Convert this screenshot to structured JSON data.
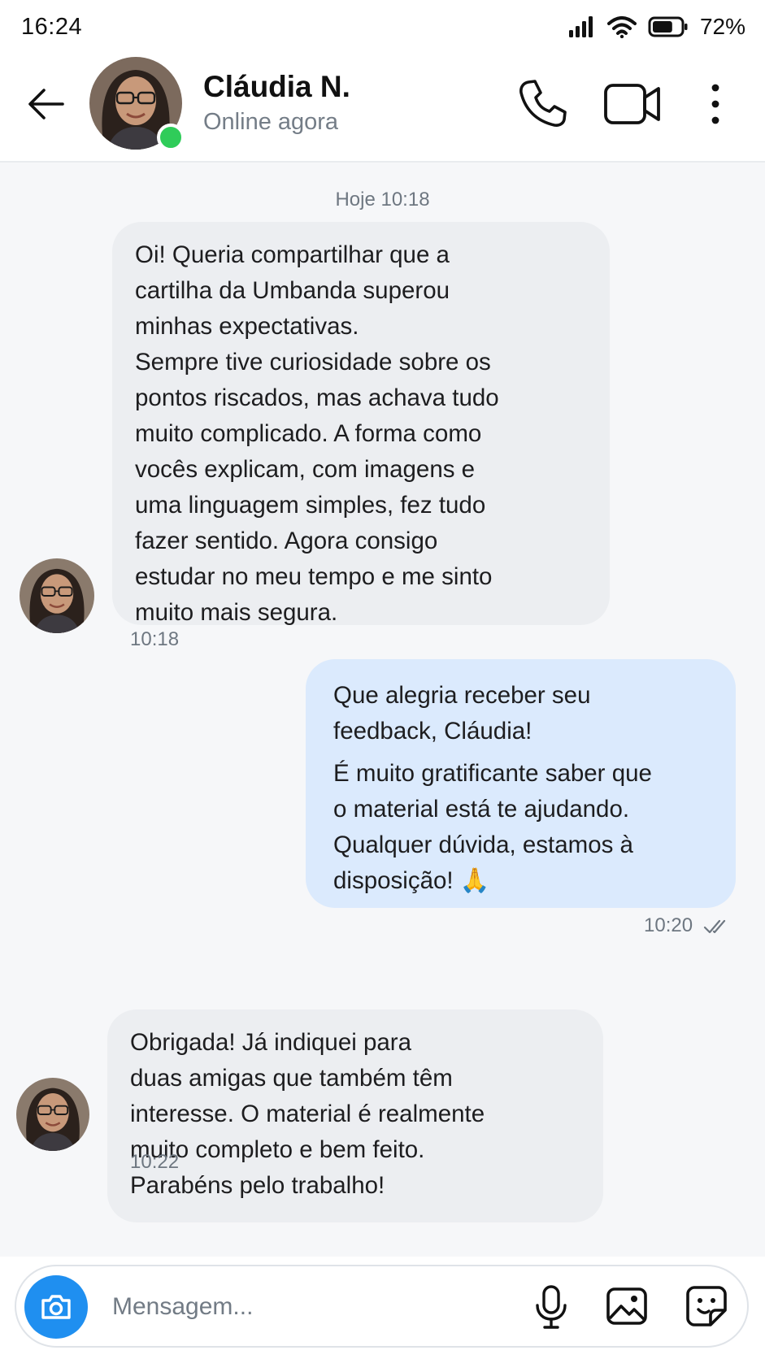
{
  "status_bar": {
    "time": "16:24",
    "battery": "72%",
    "battery_level": 0.72
  },
  "header": {
    "contact_name": "Cláudia N.",
    "contact_status": "Online agora",
    "icons": [
      "back-arrow-icon",
      "phone-icon",
      "video-camera-icon",
      "more-vertical-icon"
    ]
  },
  "chat": {
    "day_label": "Hoje 10:18",
    "messages": [
      {
        "direction": "incoming",
        "text": "Oi! Queria compartilhar que a\ncartilha da Umbanda superou\nminhas expectativas.\nSempre tive curiosidade sobre os\npontos riscados, mas achava tudo\nmuito complicado. A forma como\nvocês explicam, com imagens e\numa linguagem simples, fez tudo\nfazer sentido. Agora consigo\nestudar no meu tempo e me sinto\nmuito mais segura.",
        "time": "10:18"
      },
      {
        "direction": "outgoing",
        "text_1": "Que alegria receber seu\nfeedback, Cláudia!",
        "text_2": "É muito gratificante saber que\no material está te ajudando.\nQualquer dúvida, estamos à\ndisposição! 🙏",
        "time": "10:20",
        "status": "read"
      },
      {
        "direction": "incoming",
        "text": "Obrigada! Já indiquei para\nduas amigas que também têm\ninteresse. O material é realmente\nmuito completo e bem feito.\nParabéns pelo trabalho!",
        "time": "10:22"
      }
    ]
  },
  "composer": {
    "placeholder": "Mensagem...",
    "value": "",
    "icons": [
      "camera-icon",
      "microphone-icon",
      "image-icon",
      "sticker-icon"
    ]
  },
  "colors": {
    "accent": "#1f8ff0",
    "online": "#2fcc59",
    "incoming_bubble": "#eceef1",
    "outgoing_bubble": "#dbeafd",
    "chat_background": "#f6f7f9"
  }
}
